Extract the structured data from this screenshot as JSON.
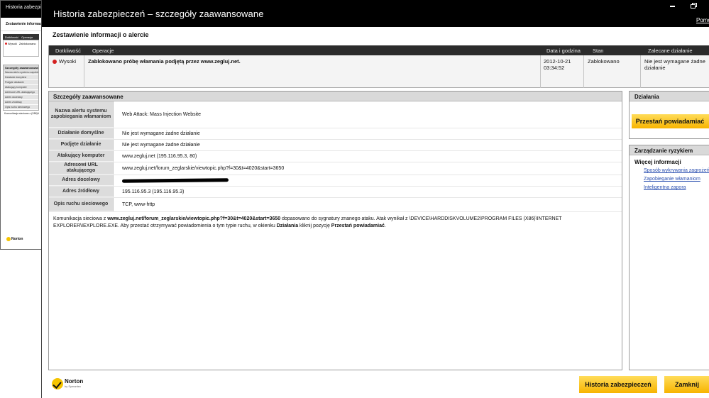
{
  "background_window": {
    "title": "Historia zabezpieczeń",
    "summary_title": "Zestawienie informacji o alercie",
    "header": [
      "Dotkliwość",
      "Operacje"
    ],
    "row": {
      "severity": "Wysoki",
      "operation": "Zablokowano"
    },
    "details_title": "Szczegóły zaawansowane",
    "labels": [
      "Nazwa alertu systemu zapobiegania włamaniom",
      "Działanie domyślne",
      "Podjęte działanie",
      "Atakujący komputer",
      "Adresowi URL atakującego",
      "Adres docelowy",
      "Adres źródłowy",
      "Opis ruchu sieciowego"
    ],
    "description": "Komunikacja sieciowa z (X86)\\INTERNET EXPLORER"
  },
  "dialog": {
    "title": "Historia zabezpieczeń – szczegóły zaawansowane",
    "help_link": "Pomoc"
  },
  "summary": {
    "title": "Zestawienie informacji o alercie",
    "columns": {
      "severity": "Dotkliwość",
      "operations": "Operacje",
      "datetime": "Data i godzina",
      "status": "Stan",
      "recommended": "Zalecane działanie"
    },
    "row": {
      "severity": "Wysoki",
      "operation": "Zablokowano próbę włamania podjętą przez www.zegluj.net.",
      "date": "2012-10-21",
      "time": "03:34:52",
      "status": "Zablokowano",
      "recommended": "Nie jest wymagane żadne działanie"
    }
  },
  "details": {
    "title": "Szczegóły zaawansowane",
    "rows": {
      "alert_name": {
        "label": "Nazwa alertu systemu zapobiegania włamaniom",
        "value": "Web Attack: Mass Injection Website"
      },
      "default_action": {
        "label": "Działanie domyślne",
        "value": "Nie jest wymagane żadne działanie"
      },
      "action_taken": {
        "label": "Podjęte działanie",
        "value": "Nie jest wymagane żadne działanie"
      },
      "attacker": {
        "label": "Atakujący komputer",
        "value": "www.zegluj.net (195.116.95.3, 80)"
      },
      "attacker_url": {
        "label": "Adresowi URL atakującego",
        "value": "www.zegluj.net/forum_zeglarskie/viewtopic.php?f=30&t=4020&start=3650"
      },
      "destination": {
        "label": "Adres docelowy",
        "value": ""
      },
      "source": {
        "label": "Adres źródłowy",
        "value": "195.116.95.3 (195.116.95.3)"
      },
      "traffic": {
        "label": "Opis ruchu sieciowego",
        "value": "TCP, www-http"
      }
    },
    "description": {
      "part1": "Komunikacja sieciowa z ",
      "url": "www.zegluj.net/forum_zeglarskie/viewtopic.php?f=30&t=4020&start=3650",
      "part2": " dopasowano do sygnatury znanego ataku. Atak wynikał z \\DEVICE\\HARDDISKVOLUME2\\PROGRAM FILES (X86)\\INTERNET EXPLORER\\IEXPLORE.EXE. Aby przestać otrzymywać powiadomienia o tym typie ruchu, w okienku ",
      "actions_word": "Działania",
      "part3": " kliknij pozycję ",
      "stop_word": "Przestań powiadamiać",
      "part4": "."
    }
  },
  "actions_panel": {
    "title": "Działania",
    "stop_button": "Przestań powiadamiać"
  },
  "risk_panel": {
    "title": "Zarządzanie ryzykiem",
    "more_info": "Więcej informacji",
    "links": [
      "Sposób wykrywania zagrożeń",
      "Zapobieganie włamaniom",
      "Inteligentna zapora"
    ]
  },
  "footer": {
    "logo_name": "Norton",
    "logo_by": "by Symantec",
    "history_button": "Historia zabezpieczeń",
    "close_button": "Zamknij"
  },
  "colors": {
    "accent_button": "#f7b400",
    "severity_high": "#d42020",
    "link": "#2a4fb0"
  }
}
